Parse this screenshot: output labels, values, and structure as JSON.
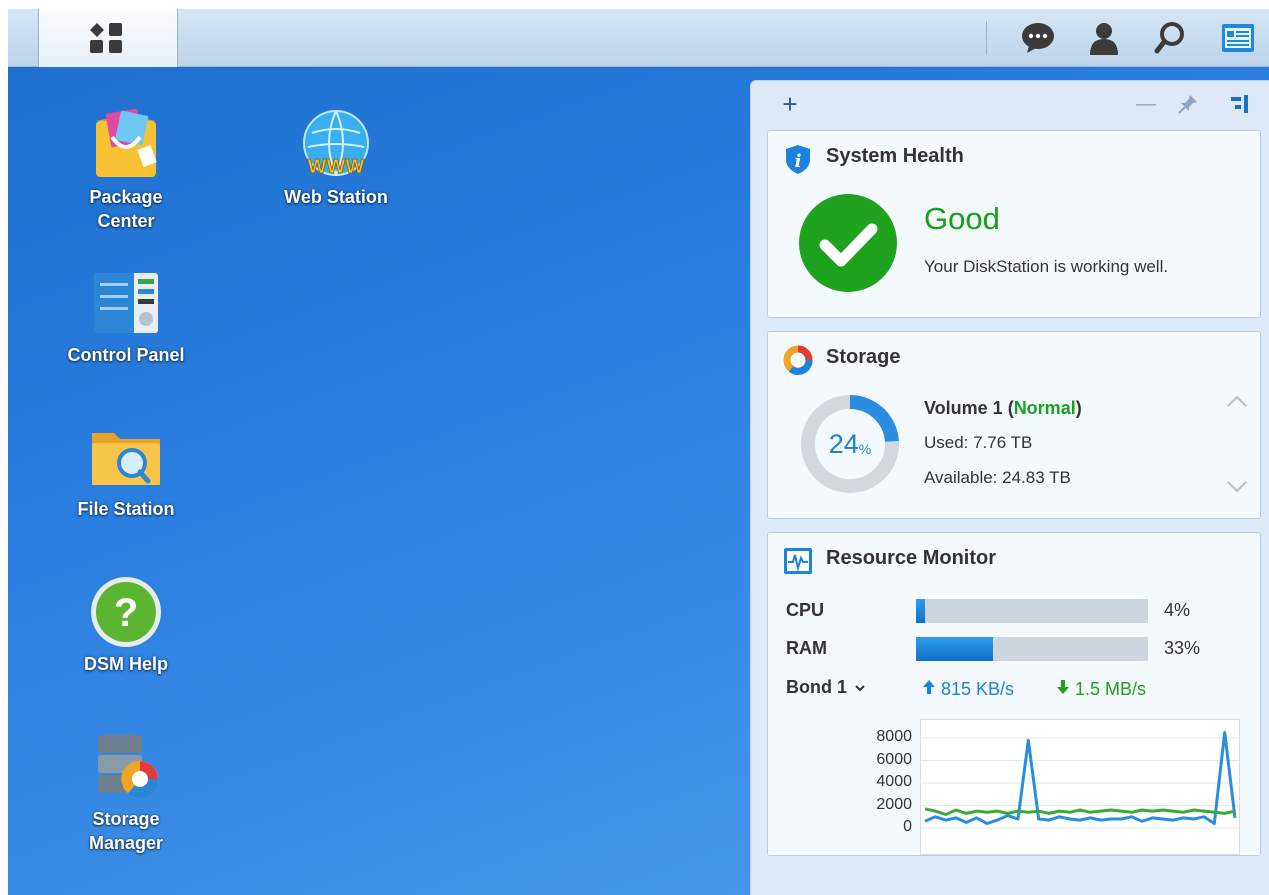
{
  "taskbar": {
    "main_menu_icon": "grid-menu-icon",
    "right_icons": [
      "chat-icon",
      "user-icon",
      "search-icon",
      "widget-toggle-icon"
    ]
  },
  "desktop": {
    "shortcuts": [
      {
        "label": "Package\nCenter",
        "icon": "package-center-icon"
      },
      {
        "label": "Web Station",
        "icon": "web-station-icon"
      },
      {
        "label": "Control Panel",
        "icon": "control-panel-icon"
      },
      {
        "label": "File Station",
        "icon": "file-station-icon"
      },
      {
        "label": "DSM Help",
        "icon": "dsm-help-icon"
      },
      {
        "label": "Storage\nManager",
        "icon": "storage-manager-icon"
      }
    ]
  },
  "widgets": {
    "toolbar": {
      "add": "+",
      "minimize": "—"
    },
    "health": {
      "title": "System Health",
      "status": "Good",
      "description": "Your DiskStation is working well.",
      "status_color": "#14a214"
    },
    "storage": {
      "title": "Storage",
      "usage_percent": "24",
      "usage_unit": "%",
      "usage_fraction": 0.24,
      "volume_name": "Volume 1 (",
      "volume_status": "Normal",
      "volume_close": ")",
      "used": "Used: 7.76 TB",
      "available": "Available: 24.83 TB"
    },
    "resource": {
      "title": "Resource Monitor",
      "cpu_label": "CPU",
      "cpu_value": 4,
      "cpu_text": "4%",
      "ram_label": "RAM",
      "ram_value": 33,
      "ram_text": "33%",
      "network_label": "Bond 1",
      "upload": "815 KB/s",
      "download": "1.5 MB/s",
      "upload_color": "#1c82dd",
      "download_color": "#1ba11b"
    }
  },
  "chart_data": {
    "type": "line",
    "title": "",
    "xlabel": "",
    "ylabel": "",
    "ylim": [
      0,
      9000
    ],
    "yticks": [
      "8000",
      "6000",
      "4000",
      "2000",
      "0"
    ],
    "x": [
      0,
      1,
      2,
      3,
      4,
      5,
      6,
      7,
      8,
      9,
      10,
      11,
      12,
      13,
      14,
      15,
      16,
      17,
      18,
      19,
      20,
      21,
      22,
      23,
      24,
      25,
      26,
      27,
      28,
      29,
      30
    ],
    "series": [
      {
        "color": "#2a8ddf",
        "values": [
          600,
          1000,
          700,
          900,
          500,
          900,
          400,
          700,
          1100,
          800,
          7800,
          800,
          700,
          1000,
          800,
          700,
          900,
          700,
          800,
          800,
          1000,
          600,
          900,
          800,
          700,
          900,
          800,
          1000,
          400,
          8500,
          900
        ]
      },
      {
        "color": "#3aaa35",
        "values": [
          1700,
          1500,
          1200,
          1600,
          1300,
          1500,
          1400,
          1500,
          1300,
          1500,
          1400,
          1500,
          1300,
          1500,
          1400,
          1600,
          1400,
          1500,
          1600,
          1500,
          1400,
          1600,
          1500,
          1600,
          1500,
          1400,
          1600,
          1500,
          1400,
          1300,
          1500
        ]
      }
    ]
  }
}
